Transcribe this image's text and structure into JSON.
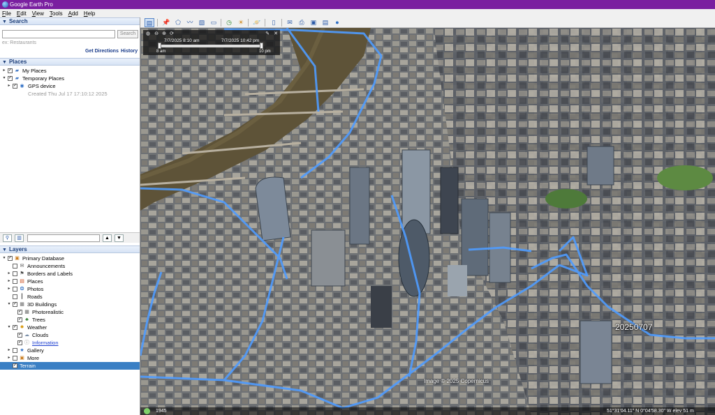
{
  "window": {
    "title": "Google Earth Pro"
  },
  "menu": [
    "File",
    "Edit",
    "View",
    "Tools",
    "Add",
    "Help"
  ],
  "search": {
    "header": "Search",
    "input_value": "",
    "button_label": "Search",
    "hint": "ex: Restaurants",
    "get_directions": "Get Directions",
    "history": "History"
  },
  "places": {
    "header": "Places",
    "items": [
      {
        "label": "My Places",
        "checked": true,
        "expanded": false
      },
      {
        "label": "Temporary Places",
        "checked": true,
        "expanded": true
      },
      {
        "label": "GPS device",
        "checked": true,
        "expanded": false
      },
      {
        "label": "Created Thu Jul 17 17:10:12 2025"
      }
    ]
  },
  "layers": {
    "header": "Layers",
    "items": [
      {
        "label": "Primary Database",
        "checked": true,
        "icon": "database-icon"
      },
      {
        "label": "Announcements",
        "checked": false,
        "icon": "mail-icon"
      },
      {
        "label": "Borders and Labels",
        "checked": false,
        "icon": "flag-icon"
      },
      {
        "label": "Places",
        "checked": false,
        "icon": "places-icon"
      },
      {
        "label": "Photos",
        "checked": false,
        "icon": "photo-icon"
      },
      {
        "label": "Roads",
        "checked": false,
        "icon": "road-icon"
      },
      {
        "label": "3D Buildings",
        "checked": true,
        "icon": "building-icon"
      },
      {
        "label": "Photorealistic",
        "checked": true,
        "icon": "building-icon"
      },
      {
        "label": "Trees",
        "checked": true,
        "icon": "tree-icon"
      },
      {
        "label": "Weather",
        "checked": true,
        "icon": "sun-icon"
      },
      {
        "label": "Clouds",
        "checked": true,
        "icon": "cloud-icon"
      },
      {
        "label": "Information",
        "checked": true,
        "icon": "info-icon"
      },
      {
        "label": "Gallery",
        "checked": false,
        "icon": "gallery-icon"
      },
      {
        "label": "More",
        "checked": false,
        "icon": "more-icon"
      },
      {
        "label": "Terrain",
        "checked": true,
        "icon": ""
      }
    ]
  },
  "time_slider": {
    "from": "7/7/2025 8:10 am",
    "to": "7/7/2025 10:42 pm",
    "start": "8 am",
    "end": "10 pm"
  },
  "map": {
    "track_label": "20250707",
    "copyright": "Image © 2025 Copernicus",
    "imagery_year": "1945",
    "coordinates": "51°31'04.11\" N 0°04'58.30\" W elev 51 m"
  },
  "colors": {
    "title_bar": "#7a1fa0",
    "track": "#4f9cff",
    "selected": "#3a7fc4"
  }
}
